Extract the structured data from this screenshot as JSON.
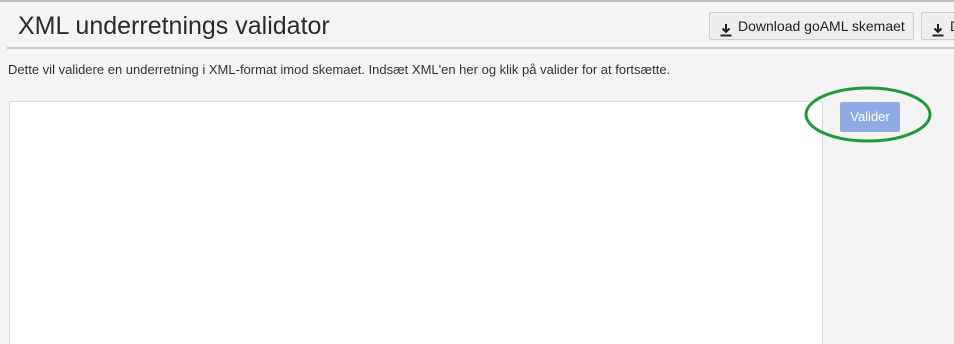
{
  "header": {
    "title": "XML underretnings validator",
    "buttons": [
      {
        "label": "Download goAML skemaet",
        "icon": "download-icon"
      },
      {
        "label": "D",
        "icon": "download-icon"
      }
    ]
  },
  "main": {
    "description": "Dette vil validere en underretning i XML-format imod skemaet. Indsæt XML'en her og klik på valider for at fortsætte.",
    "xml_input": {
      "value": "",
      "placeholder": ""
    },
    "validate_label": "Valider"
  },
  "annotation": {
    "shape": "ellipse",
    "color": "#1f9a36"
  }
}
